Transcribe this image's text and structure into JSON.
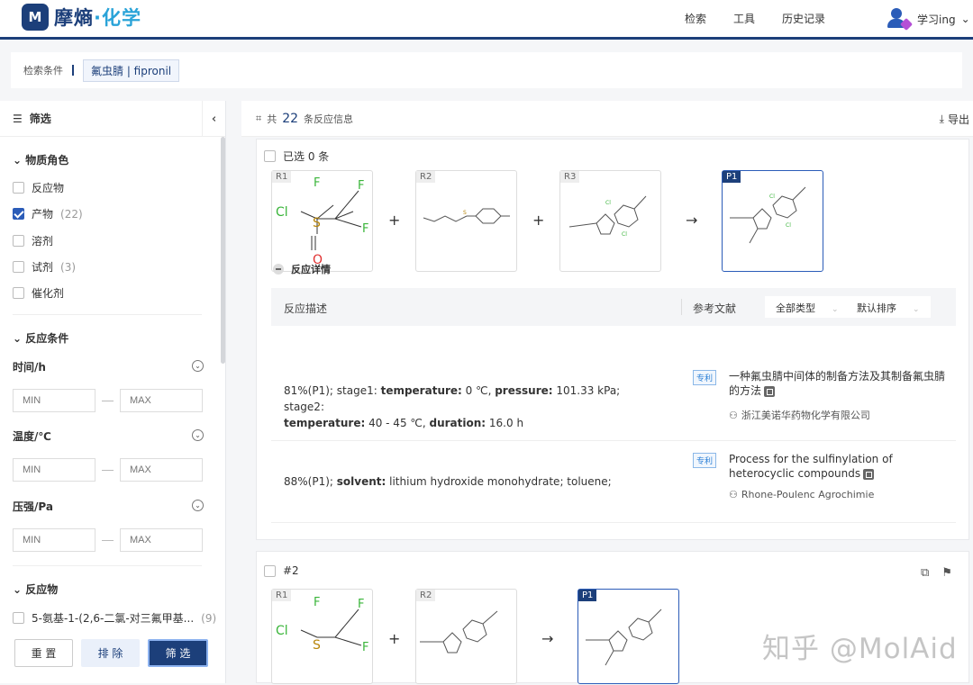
{
  "header": {
    "logo_mark": "M",
    "logo_text_main": "摩熵",
    "logo_text_accent": "·化学",
    "nav": [
      "检索",
      "工具",
      "历史记录"
    ],
    "user": "学习ing"
  },
  "conditions": {
    "label": "检索条件",
    "tag": "氟虫腈 | fipronil"
  },
  "sidebar": {
    "title": "筛选",
    "role_section": "物质角色",
    "roles": [
      {
        "label": "反应物",
        "count": "",
        "checked": false
      },
      {
        "label": "产物",
        "count": "(22)",
        "checked": true
      },
      {
        "label": "溶剂",
        "count": "",
        "checked": false
      },
      {
        "label": "试剂",
        "count": "(3)",
        "checked": false
      },
      {
        "label": "催化剂",
        "count": "",
        "checked": false
      }
    ],
    "cond_section": "反应条件",
    "fields": [
      {
        "label": "时间/h",
        "min": "MIN",
        "max": "MAX"
      },
      {
        "label": "温度/℃",
        "min": "MIN",
        "max": "MAX"
      },
      {
        "label": "压强/Pa",
        "min": "MIN",
        "max": "MAX"
      }
    ],
    "reactant_section": "反应物",
    "reactant_item": {
      "label": "5-氨基-1-(2,6-二氯-对三氟甲基...",
      "count": "(9)"
    },
    "buttons": {
      "reset": "重 置",
      "exclude": "排 除",
      "filter": "筛 选"
    }
  },
  "main": {
    "total_prefix": "共",
    "total": "22",
    "total_suffix": "条反应信息",
    "export": "导出",
    "selected": "已选 0 条",
    "details_label": "反应详情",
    "col_desc": "反应描述",
    "col_ref": "参考文献",
    "filter_type": "全部类型",
    "sort": "默认排序",
    "rows": [
      {
        "d1": "81%(P1); stage1: ",
        "k1": "temperature:",
        "v1": " 0 ℃, ",
        "k2": "pressure:",
        "v2": " 101.33 kPa; stage2:",
        "k3": "temperature:",
        "v3": " 40 - 45 ℃, ",
        "k4": "duration:",
        "v4": " 16.0 h",
        "badge": "专利",
        "ref": "一种氟虫腈中间体的制备方法及其制备氟虫腈的方法",
        "org": "浙江美诺华药物化学有限公司"
      },
      {
        "d1": "88%(P1); ",
        "k1": "solvent:",
        "v1": " lithium hydroxide monohydrate; toluene;",
        "badge": "专利",
        "ref": "Process for the sulfinylation of heterocyclic compounds",
        "org": "Rhone-Poulenc Agrochimie"
      }
    ],
    "card2_index": "#2",
    "labels": {
      "r1": "R1",
      "r2": "R2",
      "r3": "R3",
      "p1": "P1"
    }
  },
  "watermark": "知乎 @MolAid"
}
